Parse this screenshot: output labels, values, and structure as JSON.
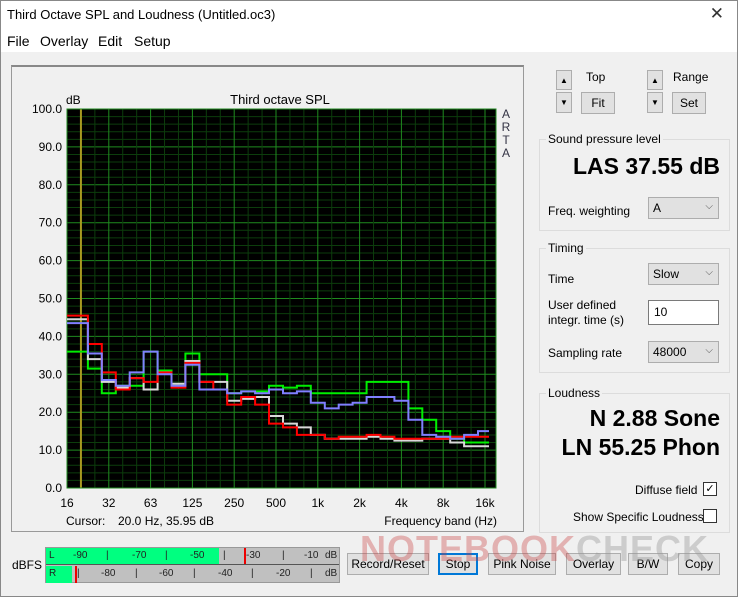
{
  "window": {
    "title": "Third Octave SPL and Loudness (Untitled.oc3)",
    "close_icon": "close-icon"
  },
  "menu": {
    "items": [
      "File",
      "Overlay",
      "Edit",
      "Setup"
    ]
  },
  "chart_data": {
    "type": "line",
    "step": true,
    "title": "Third octave SPL",
    "ylabel": "dB",
    "xlabel": "Frequency band (Hz)",
    "side_label": "ARTA",
    "ylim": [
      0,
      100
    ],
    "yticks": [
      "0.0",
      "10.0",
      "20.0",
      "30.0",
      "40.0",
      "50.0",
      "60.0",
      "70.0",
      "80.0",
      "90.0",
      "100.0"
    ],
    "xtick_labels": [
      "16",
      "32",
      "63",
      "125",
      "250",
      "500",
      "1k",
      "2k",
      "4k",
      "8k",
      "16k"
    ],
    "x": [
      "16",
      "20",
      "25",
      "31.5",
      "40",
      "50",
      "63",
      "80",
      "100",
      "125",
      "160",
      "200",
      "250",
      "315",
      "400",
      "500",
      "630",
      "800",
      "1k",
      "1.25k",
      "1.6k",
      "2k",
      "2.5k",
      "3.15k",
      "4k",
      "5k",
      "6.3k",
      "8k",
      "10k",
      "12.5k",
      "16k"
    ],
    "cursor_marker_hz": "20",
    "grid": true,
    "series": [
      {
        "name": "green",
        "color": "#00ee00",
        "values": [
          36,
          36,
          31.5,
          25,
          27,
          27,
          36,
          31,
          27,
          35.5,
          30,
          30,
          25,
          25.5,
          25.5,
          27,
          26.5,
          27,
          25,
          25,
          25,
          25,
          28,
          28,
          28,
          21,
          18,
          15,
          13,
          12,
          12
        ]
      },
      {
        "name": "white",
        "color": "#d8d8d8",
        "values": [
          44.5,
          44.5,
          34,
          28,
          26.5,
          29,
          26,
          30.5,
          27.5,
          33.5,
          28,
          28,
          23,
          23.5,
          24,
          19,
          17,
          16,
          14,
          13,
          13,
          13,
          13.5,
          13,
          12.5,
          12.5,
          13,
          13,
          12,
          11,
          11
        ]
      },
      {
        "name": "red",
        "color": "#ff0000",
        "values": [
          45.5,
          45.5,
          38,
          30.5,
          26,
          29,
          28,
          30.5,
          26.5,
          33,
          28,
          26,
          22,
          24,
          22,
          17,
          16,
          14,
          14,
          13,
          13.5,
          13.5,
          14,
          13.5,
          13,
          13,
          13,
          13,
          13.5,
          13.5,
          13.5
        ]
      },
      {
        "name": "blue",
        "color": "#8080ff",
        "values": [
          43.5,
          43.5,
          35.5,
          28.5,
          27,
          30.5,
          36,
          30,
          27,
          32.5,
          26,
          26,
          25,
          25.5,
          25,
          26,
          25,
          25.5,
          22.5,
          21,
          22,
          22.5,
          24,
          24,
          23,
          18,
          14,
          13.5,
          13,
          14,
          15
        ]
      }
    ]
  },
  "cursor_readout": {
    "label": "Cursor:",
    "value": "20.0 Hz, 35.95 dB"
  },
  "controls": {
    "top_label": "Top",
    "fit_label": "Fit",
    "range_label": "Range",
    "set_label": "Set"
  },
  "spl": {
    "group_title": "Sound pressure level",
    "value": "LAS 37.55 dB",
    "freq_weighting_label": "Freq. weighting",
    "freq_weighting_value": "A"
  },
  "timing": {
    "group_title": "Timing",
    "time_label": "Time",
    "time_value": "Slow",
    "integr_label_1": "User defined",
    "integr_label_2": "integr. time (s)",
    "integr_value": "10",
    "sampling_label": "Sampling rate",
    "sampling_value": "48000"
  },
  "loudness": {
    "group_title": "Loudness",
    "sone": "N 2.88 Sone",
    "phon": "LN 55.25 Phon",
    "diffuse_label": "Diffuse field",
    "diffuse_checked": "✓",
    "specific_label": "Show Specific Loudness"
  },
  "meter": {
    "label": "dBFS",
    "left_channel": "L",
    "right_channel": "R",
    "left_ticks": [
      "-90",
      "|",
      "-70",
      "|",
      "-50",
      "|",
      "-30",
      "|",
      "-10",
      "dB"
    ],
    "right_ticks": [
      "|",
      "-80",
      "|",
      "-60",
      "|",
      "-40",
      "|",
      "-20",
      "|",
      "dB"
    ],
    "left_level_fraction": 0.59,
    "right_level_fraction": 0.09
  },
  "buttons": [
    "Record/Reset",
    "Stop",
    "Pink Noise",
    "Overlay",
    "B/W",
    "Copy"
  ],
  "watermark": {
    "part1": "NOTEBOOK",
    "part2": "CHECK"
  }
}
